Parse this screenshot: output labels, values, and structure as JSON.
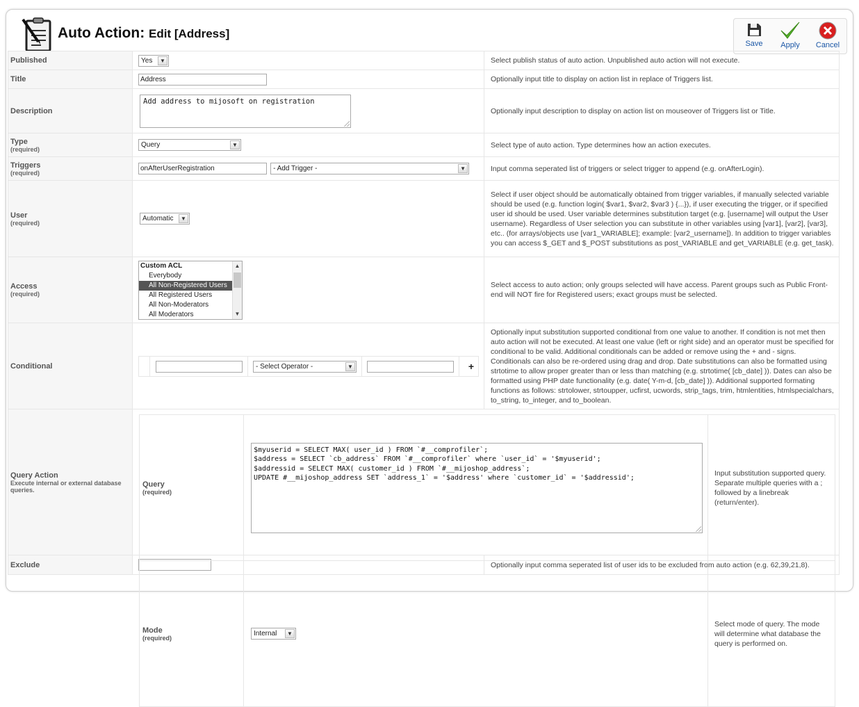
{
  "header": {
    "title": "Auto Action:",
    "subtitle": "Edit [Address]",
    "icon": "clipboard-pen-icon"
  },
  "toolbar": {
    "save_label": "Save",
    "apply_label": "Apply",
    "cancel_label": "Cancel",
    "colors": {
      "save": "#333333",
      "apply": "#58b32b",
      "cancel": "#d81f1f",
      "link": "#1b57a6"
    }
  },
  "fields": {
    "published": {
      "label": "Published",
      "value": "Yes",
      "desc": "Select publish status of auto action. Unpublished auto action will not execute."
    },
    "title": {
      "label": "Title",
      "value": "Address",
      "desc": "Optionally input title to display on action list in replace of Triggers list."
    },
    "description": {
      "label": "Description",
      "value": "Add address to mijosoft on registration",
      "desc": "Optionally input description to display on action list on mouseover of Triggers list or Title."
    },
    "type": {
      "label": "Type",
      "req": "(required)",
      "value": "Query",
      "desc": "Select type of auto action. Type determines how an action executes."
    },
    "triggers": {
      "label": "Triggers",
      "req": "(required)",
      "value": "onAfterUserRegistration",
      "add": "- Add Trigger -",
      "desc": "Input comma seperated list of triggers or select trigger to append (e.g. onAfterLogin)."
    },
    "user": {
      "label": "User",
      "req": "(required)",
      "value": "Automatic",
      "desc": "Select if user object should be automatically obtained from trigger variables, if manually selected variable should be used (e.g. function login( $var1, $var2, $var3 ) {...}), if user executing the trigger, or if specified user id should be used. User variable determines substitution target (e.g. [username] will output the User username). Regardless of User selection you can substitute in other variables using [var1], [var2], [var3], etc.. (for arrays/objects use [var1_VARIABLE]; example: [var2_username]). In addition to trigger variables you can access $_GET and $_POST substitutions as post_VARIABLE and get_VARIABLE (e.g. get_task)."
    },
    "access": {
      "label": "Access",
      "req": "(required)",
      "options": [
        {
          "text": "Custom ACL",
          "group": true,
          "selected": false
        },
        {
          "text": "Everybody",
          "group": false,
          "selected": false
        },
        {
          "text": "All Non-Registered Users",
          "group": false,
          "selected": true
        },
        {
          "text": "All Registered Users",
          "group": false,
          "selected": false
        },
        {
          "text": "All Non-Moderators",
          "group": false,
          "selected": false
        },
        {
          "text": "All Moderators",
          "group": false,
          "selected": false
        }
      ],
      "desc": "Select access to auto action; only groups selected will have access. Parent groups such as Public Front-end will NOT fire for Registered users; exact groups must be selected."
    },
    "conditional": {
      "label": "Conditional",
      "operator": "- Select Operator -",
      "plus": "+",
      "desc": "Optionally input substitution supported conditional from one value to another. If condition is not met then auto action will not be executed. At least one value (left or right side) and an operator must be specified for conditional to be valid. Additional conditionals can be added or remove using the + and - signs. Conditionals can also be re-ordered using drag and drop. Date substitutions can also be formatted using strtotime to allow proper greater than or less than matching (e.g. strtotime( [cb_date] )). Dates can also be formatted using PHP date functionality (e.g. date( Y-m-d, [cb_date] )). Additional supported formating functions as follows: strtolower, strtoupper, ucfirst, ucwords, strip_tags, trim, htmlentities, htmlspecialchars, to_string, to_integer, and to_boolean."
    },
    "query_action": {
      "label": "Query Action",
      "sub": "Execute internal or external database queries.",
      "query": {
        "label": "Query",
        "req": "(required)",
        "lines": [
          "$myuserid = SELECT MAX( user_id ) FROM `#__comprofiler`;",
          "$address = SELECT `cb_address` FROM `#__comprofiler` where `user_id` = '$myuserid';",
          "$addressid = SELECT MAX( customer_id ) FROM `#__mijoshop_address`;",
          "UPDATE #__mijoshop_address SET `address_1` = '$address' where `customer_id` = '$addressid';"
        ],
        "desc": "Input substitution supported query. Separate multiple queries with a ; followed by a linebreak (return/enter)."
      },
      "mode": {
        "label": "Mode",
        "req": "(required)",
        "value": "Internal",
        "desc": "Select mode of query. The mode will determine what database the query is performed on."
      }
    },
    "exclude": {
      "label": "Exclude",
      "value": "",
      "desc": "Optionally input comma seperated list of user ids to be excluded from auto action (e.g. 62,39,21,8)."
    }
  }
}
